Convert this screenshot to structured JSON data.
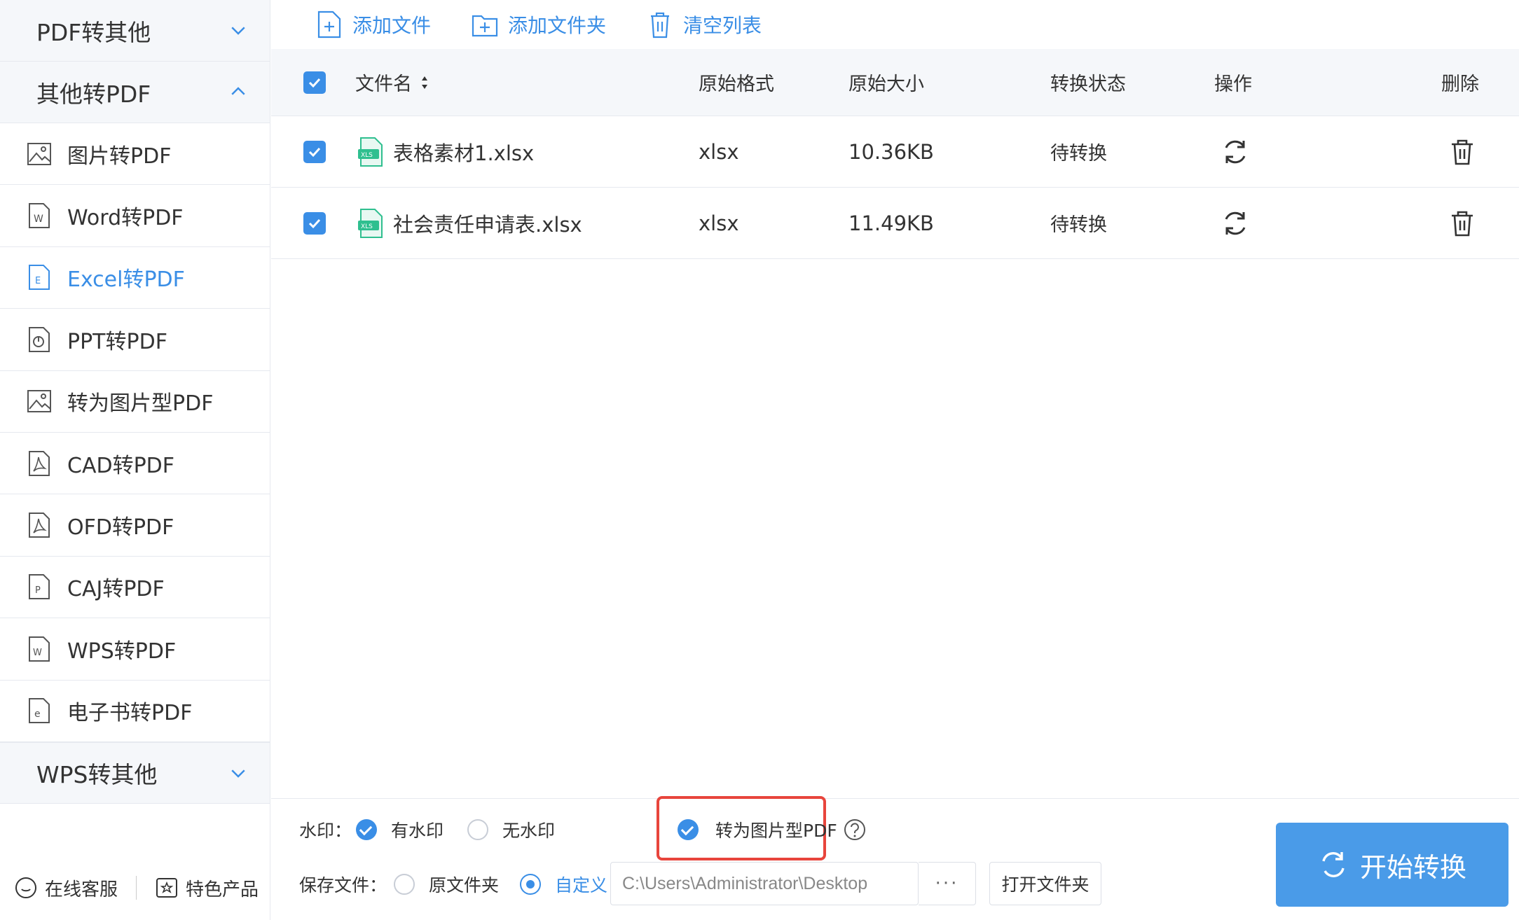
{
  "sidebar": {
    "cat_pdf_to_other": "PDF转其他",
    "cat_other_to_pdf": "其他转PDF",
    "cat_wps_to_other": "WPS转其他",
    "items": [
      {
        "label": "图片转PDF",
        "icon": "image-icon"
      },
      {
        "label": "Word转PDF",
        "icon": "word-icon"
      },
      {
        "label": "Excel转PDF",
        "icon": "excel-icon",
        "active": true
      },
      {
        "label": "PPT转PDF",
        "icon": "ppt-icon"
      },
      {
        "label": "转为图片型PDF",
        "icon": "image-icon"
      },
      {
        "label": "CAD转PDF",
        "icon": "pdf-icon"
      },
      {
        "label": "OFD转PDF",
        "icon": "pdf-icon"
      },
      {
        "label": "CAJ转PDF",
        "icon": "caj-icon"
      },
      {
        "label": "WPS转PDF",
        "icon": "wps-icon"
      },
      {
        "label": "电子书转PDF",
        "icon": "ebook-icon"
      }
    ],
    "footer": {
      "service": "在线客服",
      "featured": "特色产品"
    }
  },
  "toolbar": {
    "add_file": "添加文件",
    "add_folder": "添加文件夹",
    "clear_list": "清空列表"
  },
  "table": {
    "headers": {
      "filename": "文件名",
      "format": "原始格式",
      "size": "原始大小",
      "status": "转换状态",
      "action": "操作",
      "delete": "删除"
    },
    "rows": [
      {
        "filename": "表格素材1.xlsx",
        "format": "xlsx",
        "size": "10.36KB",
        "status": "待转换"
      },
      {
        "filename": "社会责任申请表.xlsx",
        "format": "xlsx",
        "size": "11.49KB",
        "status": "待转换"
      }
    ]
  },
  "options": {
    "watermark_label": "水印：",
    "with_watermark": "有水印",
    "no_watermark": "无水印",
    "to_image_pdf": "转为图片型PDF",
    "save_label": "保存文件：",
    "original_folder": "原文件夹",
    "custom": "自定义",
    "path": "C:\\Users\\Administrator\\Desktop",
    "browse": "···",
    "open_folder": "打开文件夹",
    "start": "开始转换"
  },
  "colors": {
    "accent": "#3a8ee6",
    "highlight": "#e8453c",
    "excel": "#2fbf8f"
  }
}
